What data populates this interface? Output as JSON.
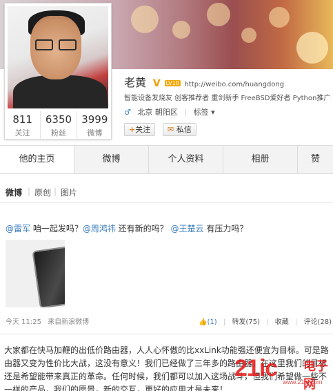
{
  "profile": {
    "name": "老黄",
    "level_badge": "LV10",
    "homepage": "http://weibo.com/huangdong",
    "intro": "智能设备发烧友 创客推荐者 重剑新手 FreeBSD爱好者 Python推广者",
    "location": "北京 朝阳区",
    "tag_label": "标签",
    "follow_label": "关注",
    "message_label": "私信",
    "stats": [
      {
        "value": "811",
        "label": "关注"
      },
      {
        "value": "6350",
        "label": "粉丝"
      },
      {
        "value": "3999",
        "label": "微博"
      }
    ]
  },
  "tabs": [
    "他的主页",
    "微博",
    "个人资料",
    "相册",
    "赞"
  ],
  "subnav": [
    "微博",
    "原创",
    "图片"
  ],
  "post": {
    "mention1": "@雷军",
    "text1": " 咱一起发吗？",
    "mention2": "@周鸿祎",
    "text2": " 还有新的吗？ ",
    "mention3": "@王楚云",
    "text3": " 有压力吗？",
    "time": "今天 11:25",
    "source": "来自新浪微博",
    "like": "(1)",
    "repost": "转发(75)",
    "favorite": "收藏",
    "comment": "评论(28)"
  },
  "article": {
    "text": "大家都在快马加鞭的出低价路由器，人人心怀傲的比xxLink功能强还便宜为目标。可是路由器又变为性价比大战，这没有意义！我们已经做了三年多的路由器，在这里我们的目标还是希望能带来真正的革命。任何时候，我们都可以加入这场战斗，但我们希望做一些不一样的产品，我们的愿景，新的交互，更好的应用才是未来！"
  },
  "watermark": {
    "brand": "21ic",
    "brand_cn": "电子网",
    "url": "www.21ic.com"
  }
}
